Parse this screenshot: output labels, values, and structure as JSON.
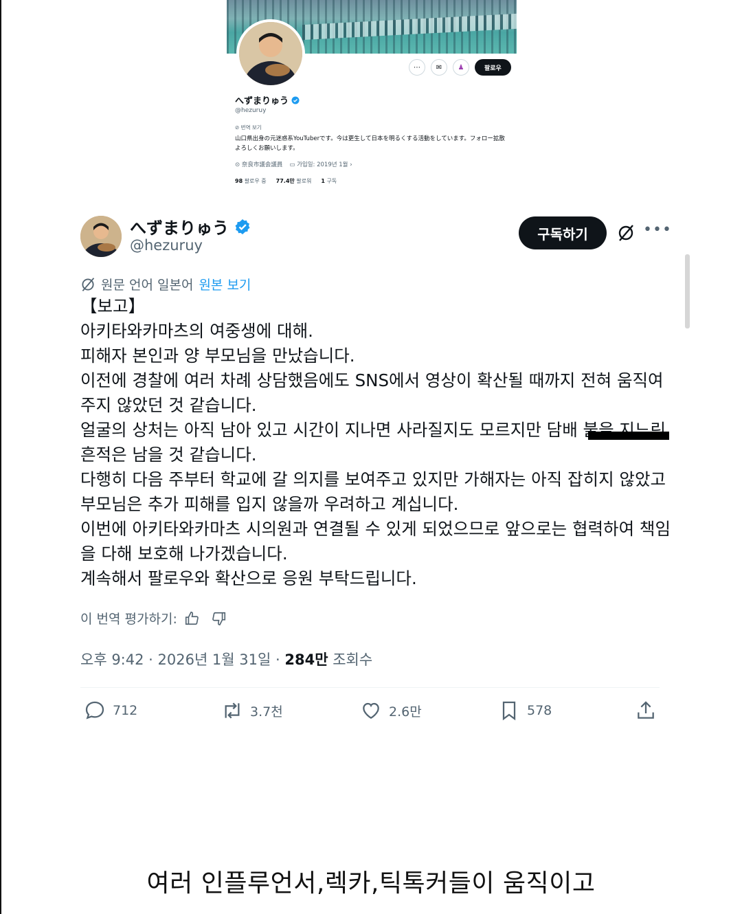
{
  "profile_card": {
    "name": "へずまりゅう",
    "handle": "@hezuruy",
    "follow_button": "팔로우",
    "translate_label": "번역 보기",
    "bio": "山口県出身の元迷惑系YouTuberです。今は更生して日本を明るくする活動をしています。フォロー拡散よろしくお願いします。",
    "location": "奈良市議会議員",
    "joined": "가입일: 2019년 1월",
    "following_count": "98",
    "following_label": "팔로우 중",
    "followers_count": "77.4만",
    "followers_label": "팔로워",
    "subscriptions_count": "1",
    "subscriptions_label": "구독"
  },
  "tweet": {
    "author_name": "へずまりゅう",
    "author_handle": "@hezuruy",
    "subscribe_button": "구독하기",
    "translated_notice": "원문 언어 일본어",
    "show_original": "원본 보기",
    "lines": [
      "【보고】",
      "아키타와카마츠의 여중생에 대해.",
      "피해자 본인과 양 부모님을 만났습니다.",
      "이전에 경찰에 여러 차례 상담했음에도 SNS에서 영상이 확산될 때까지 전혀 움직여주지 않았던 것 같습니다.",
      "얼굴의 상처는 아직 남아 있고 시간이 지나면 사라질지도 모르지만 담배 불을 지느린 흔적은 남을 것 같습니다.",
      "다행히 다음 주부터 학교에 갈 의지를 보여주고 있지만 가해자는 아직 잡히지 않았고 부모님은 추가 피해를 입지 않을까 우려하고 계십니다.",
      "이번에 아키타와카마츠 시의원과 연결될 수 있게 되었으므로 앞으로는 협력하여 책임을 다해 보호해 나가겠습니다.",
      "계속해서 팔로우와 확산으로 응원 부탁드립니다."
    ],
    "rate_translation": "이 번역 평가하기:",
    "time": "오후 9:42 · 2026년 1월 31일 · ",
    "views_count": "284만",
    "views_label": "조회수"
  },
  "actions": {
    "replies": "712",
    "reposts": "3.7천",
    "likes": "2.6만",
    "bookmarks": "578"
  },
  "icons": [
    "more-icon",
    "mail-icon",
    "notify-icon",
    "verified-icon",
    "grok-icon",
    "reply-icon",
    "repost-icon",
    "like-icon",
    "bookmark-icon",
    "share-icon",
    "thumbs-up-icon",
    "thumbs-down-icon",
    "location-icon",
    "calendar-icon"
  ],
  "colors": {
    "accent": "#1d9bf0",
    "text": "#0f1419",
    "muted": "#536471",
    "button": "#0f1419"
  },
  "caption": "여러 인플루언서,렉카,틱톡커들이 움직이고"
}
